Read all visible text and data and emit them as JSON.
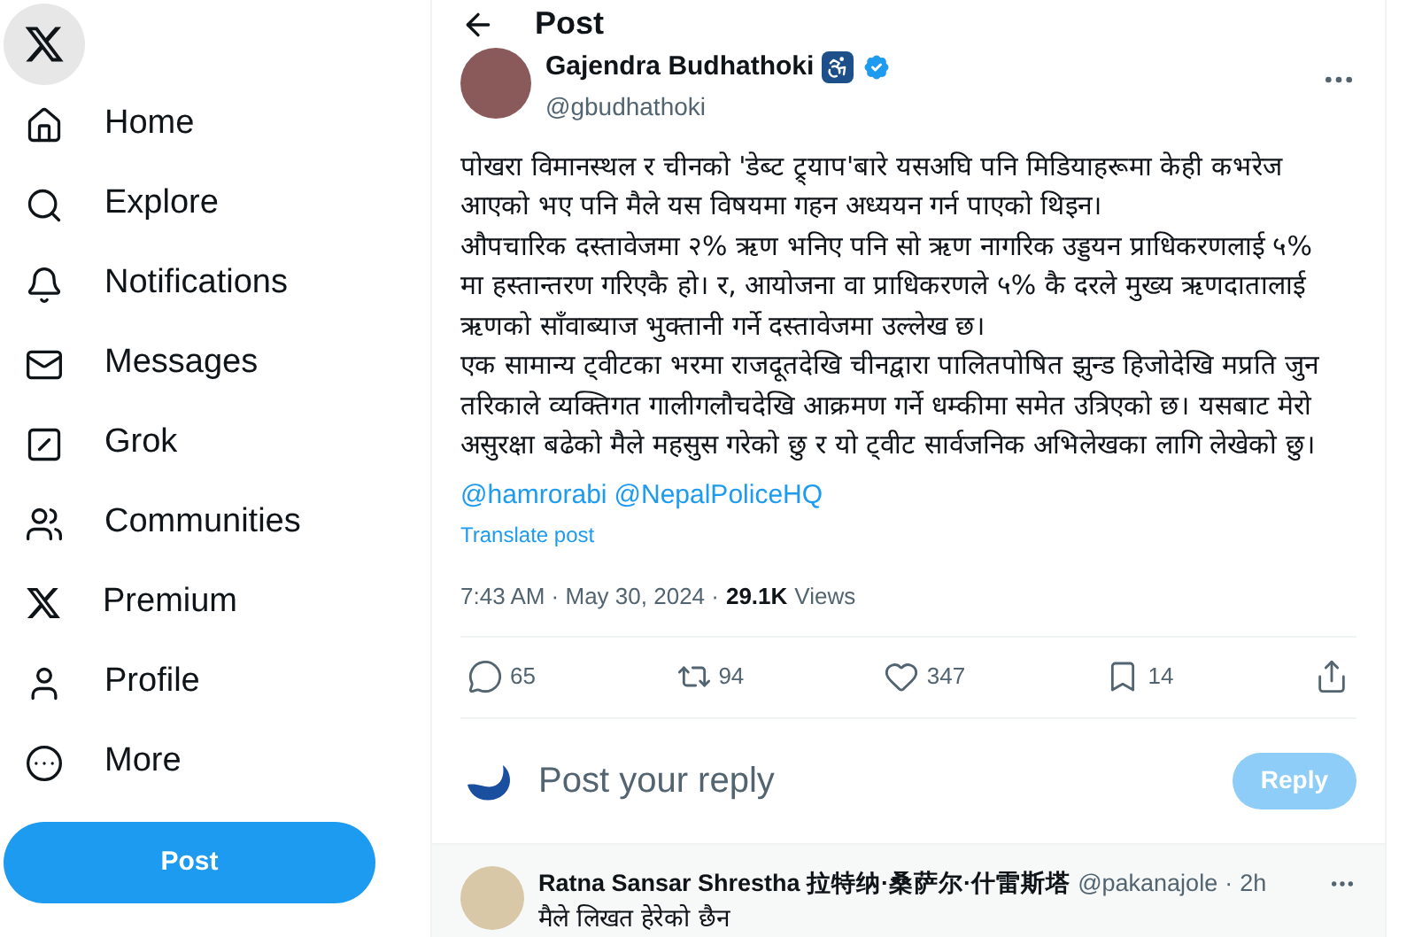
{
  "sidebar": {
    "items": [
      {
        "label": "Home",
        "selected": false
      },
      {
        "label": "Explore",
        "selected": false
      },
      {
        "label": "Notifications",
        "selected": false
      },
      {
        "label": "Messages",
        "selected": false
      },
      {
        "label": "Grok",
        "selected": false
      },
      {
        "label": "Communities",
        "selected": false
      },
      {
        "label": "Premium",
        "selected": false
      },
      {
        "label": "Profile",
        "selected": false
      },
      {
        "label": "More",
        "selected": false
      }
    ],
    "post_button": "Post"
  },
  "header": {
    "title": "Post"
  },
  "post": {
    "author": "Gajendra Budhathoki",
    "handle": "@gbudhathoki",
    "verified": true,
    "paragraphs": [
      "पोखरा विमानस्थल र चीनको 'डेब्ट ट्र्याप'बारे यसअघि पनि मिडियाहरूमा केही कभरेज आएको भए पनि मैले यस विषयमा गहन अध्ययन गर्न पाएको थिइन।",
      "औपचारिक दस्तावेजमा २% ऋण भनिए पनि सो ऋण नागरिक उड्डयन प्राधिकरणलाई ५% मा हस्तान्तरण गरिएकै हो। र, आयोजना वा प्राधिकरणले ५% कै दरले मुख्य ऋणदातालाई ऋणको साँवाब्याज भुक्तानी गर्ने दस्तावेजमा उल्लेख छ।",
      "एक सामान्य ट्वीटका भरमा राजदूतदेखि चीनद्वारा पालितपोषित झुन्ड हिजोदेखि मप्रति जुन तरिकाले व्यक्तिगत गालीगलौचदेखि आक्रमण गर्ने धम्कीमा समेत उत्रिएको छ। यसबाट मेरो असुरक्षा बढेको मैले महसुस गरेको छु र यो ट्वीट सार्वजनिक अभिलेखका लागि लेखेको छु।"
    ],
    "mentions": [
      "@hamrorabi",
      "@NepalPoliceHQ"
    ],
    "translate": "Translate post",
    "time": "7:43 AM · May 30, 2024 ·",
    "views_count": "29.1K",
    "views_label": "Views",
    "actions": [
      {
        "kind": "reply",
        "count": "65"
      },
      {
        "kind": "repost",
        "count": "94"
      },
      {
        "kind": "like",
        "count": "347"
      },
      {
        "kind": "bookmark",
        "count": "14"
      },
      {
        "kind": "share"
      }
    ]
  },
  "composer": {
    "placeholder": "Post your reply",
    "button": "Reply",
    "disabled": true
  },
  "reply": {
    "author": "Ratna Sansar Shrestha 拉特纳·桑萨尔·什雷斯塔",
    "handle": "@pakanajole",
    "separator": "·",
    "time": "2h",
    "text": "मैले लिखत हेरेको छैन"
  }
}
